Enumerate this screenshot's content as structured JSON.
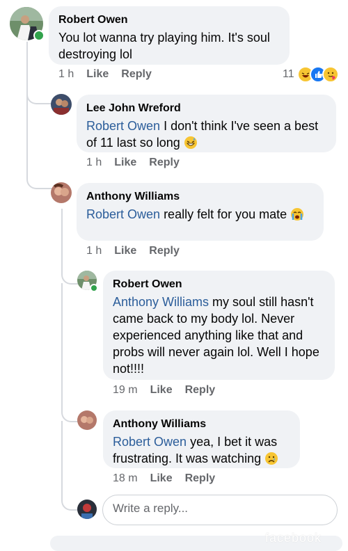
{
  "comments": [
    {
      "author": "Robert Owen",
      "mention": "",
      "text": "You lot wanna try playing him. It's soul destroying lol",
      "time": "1 h",
      "like_label": "Like",
      "reply_label": "Reply",
      "reaction_count": "11",
      "reactions": [
        "laughing-emoji",
        "like-reaction",
        "care-emoji"
      ]
    },
    {
      "author": "Lee John Wreford",
      "mention": "Robert Owen",
      "text": " I don't think I've seen a best of 11 last so long ",
      "emoji": "grinning-sweat-emoji",
      "time": "1 h",
      "like_label": "Like",
      "reply_label": "Reply"
    },
    {
      "author": "Anthony Williams",
      "mention": "Robert Owen",
      "text": " really felt for you mate ",
      "emoji": "crying-emoji",
      "time": "1 h",
      "like_label": "Like",
      "reply_label": "Reply"
    },
    {
      "author": "Robert Owen",
      "mention": "Anthony Williams",
      "text": "  my soul still hasn't came back to my body lol. Never experienced anything like that and probs will never again lol. Well I hope not!!!!",
      "time": "19 m",
      "like_label": "Like",
      "reply_label": "Reply"
    },
    {
      "author": "Anthony Williams",
      "mention": "Robert Owen",
      "text": " yea, I bet it was frustrating. It was watching ",
      "emoji": "sad-emoji",
      "time": "18 m",
      "like_label": "Like",
      "reply_label": "Reply"
    }
  ],
  "reply_box": {
    "placeholder": "Write a reply..."
  },
  "watermark": "facebook",
  "colors": {
    "bubble": "#f0f2f5",
    "mention": "#2b5d9a",
    "meta": "#65676b",
    "online": "#31a24c",
    "like_blue": "#1877f2"
  }
}
